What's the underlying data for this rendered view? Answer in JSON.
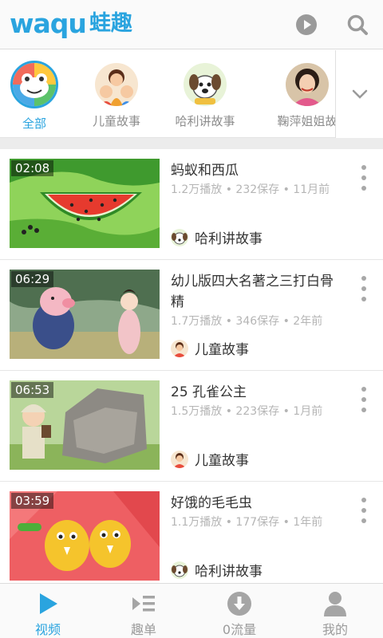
{
  "header": {
    "logo_latin": "waqu",
    "logo_cjk": "蛙趣",
    "play_icon": "play-circle-icon",
    "search_icon": "search-icon"
  },
  "categories": [
    {
      "label": "全部",
      "active": true,
      "icon": "frog-mascot-icon"
    },
    {
      "label": "儿童故事",
      "active": false,
      "icon": "kids-avatar"
    },
    {
      "label": "哈利讲故事",
      "active": false,
      "icon": "puppy-avatar"
    },
    {
      "label": "鞠萍姐姐故",
      "active": false,
      "icon": "host-avatar"
    }
  ],
  "videos": [
    {
      "duration": "02:08",
      "title": "蚂蚁和西瓜",
      "meta": "1.2万播放 • 232保存 • 11月前",
      "channel": "哈利讲故事"
    },
    {
      "duration": "06:29",
      "title": "幼儿版四大名著之三打白骨精",
      "meta": "1.7万播放 • 346保存 • 2年前",
      "channel": "儿童故事"
    },
    {
      "duration": "06:53",
      "title": "25 孔雀公主",
      "meta": "1.5万播放 • 223保存 • 1月前",
      "channel": "儿童故事"
    },
    {
      "duration": "03:59",
      "title": "好饿的毛毛虫",
      "meta": "1.1万播放 • 177保存 • 1年前",
      "channel": "哈利讲故事"
    }
  ],
  "nav": [
    {
      "label": "视频",
      "active": true,
      "icon": "play-triangle-icon"
    },
    {
      "label": "趣单",
      "active": false,
      "icon": "playlist-icon"
    },
    {
      "label": "0流量",
      "active": false,
      "icon": "download-icon"
    },
    {
      "label": "我的",
      "active": false,
      "icon": "user-icon"
    }
  ],
  "colors": {
    "accent": "#2aa4df",
    "muted": "#9b9b9b"
  }
}
